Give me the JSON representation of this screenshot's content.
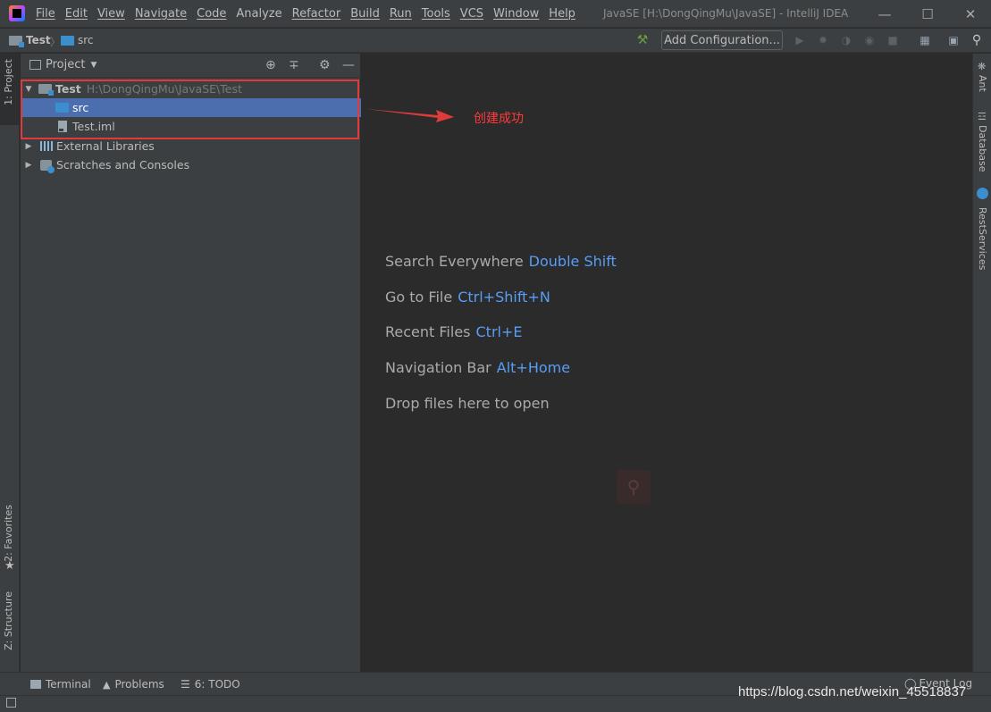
{
  "menu": [
    "File",
    "Edit",
    "View",
    "Navigate",
    "Code",
    "Analyze",
    "Refactor",
    "Build",
    "Run",
    "Tools",
    "VCS",
    "Window",
    "Help"
  ],
  "window_title": "JavaSE [H:\\DongQingMu\\JavaSE] - IntelliJ IDEA",
  "breadcrumb": {
    "project": "Test",
    "folder": "src"
  },
  "toolbar": {
    "add_config": "Add Configuration..."
  },
  "left_tabs": {
    "project": "1: Project",
    "favorites": "2: Favorites",
    "structure": "Z: Structure"
  },
  "right_tabs": {
    "ant": "Ant",
    "database": "Database",
    "rest": "RestServices"
  },
  "panel": {
    "title": "Project"
  },
  "tree": {
    "root_name": "Test",
    "root_path": "H:\\DongQingMu\\JavaSE\\Test",
    "src": "src",
    "iml": "Test.iml",
    "libs": "External Libraries",
    "scratches": "Scratches and Consoles"
  },
  "hints": [
    {
      "label": "Search Everywhere",
      "key": "Double Shift"
    },
    {
      "label": "Go to File",
      "key": "Ctrl+Shift+N"
    },
    {
      "label": "Recent Files",
      "key": "Ctrl+E"
    },
    {
      "label": "Navigation Bar",
      "key": "Alt+Home"
    },
    {
      "label": "Drop files here to open",
      "key": ""
    }
  ],
  "annotation": {
    "text": "创建成功",
    "color": "#ff3b3b"
  },
  "bottom_tabs": {
    "terminal": "Terminal",
    "problems": "Problems",
    "todo": "6: TODO",
    "event_log": "Event Log"
  },
  "watermark": "https://blog.csdn.net/weixin_45518837"
}
